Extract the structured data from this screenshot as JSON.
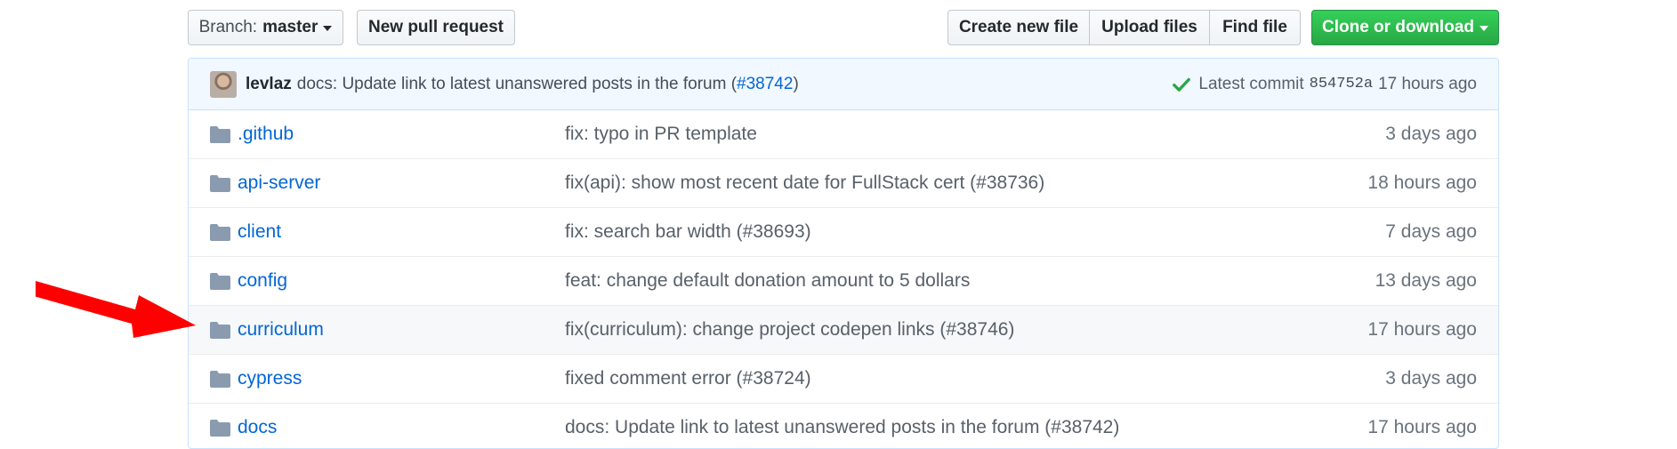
{
  "toolbar": {
    "branch_prefix": "Branch:",
    "branch_name": "master",
    "new_pr": "New pull request",
    "create_file": "Create new file",
    "upload_files": "Upload files",
    "find_file": "Find file",
    "clone": "Clone or download"
  },
  "commit": {
    "author": "levlaz",
    "message": "docs: Update link to latest unanswered posts in the forum (",
    "pr_link": "#38742",
    "message_end": ")",
    "status_icon": "check-icon",
    "latest_label": "Latest commit",
    "sha": "854752a",
    "age": "17 hours ago"
  },
  "files": [
    {
      "name": ".github",
      "message": "fix: typo in PR template",
      "age": "3 days ago"
    },
    {
      "name": "api-server",
      "message": "fix(api): show most recent date for FullStack cert (#38736)",
      "age": "18 hours ago"
    },
    {
      "name": "client",
      "message": "fix: search bar width (#38693)",
      "age": "7 days ago"
    },
    {
      "name": "config",
      "message": "feat: change default donation amount to 5 dollars",
      "age": "13 days ago"
    },
    {
      "name": "curriculum",
      "message": "fix(curriculum): change project codepen links (#38746)",
      "age": "17 hours ago"
    },
    {
      "name": "cypress",
      "message": "fixed comment error (#38724)",
      "age": "3 days ago"
    },
    {
      "name": "docs",
      "message": "docs: Update link to latest unanswered posts in the forum (#38742)",
      "age": "17 hours ago"
    }
  ],
  "colors": {
    "link": "#0366d6",
    "green_button": "#2ea44f",
    "commit_bar_bg": "#f1f8ff",
    "annotation_arrow": "#ff0000"
  },
  "icons": {
    "row_icon": "folder-icon",
    "annotation": "red-arrow-icon"
  }
}
